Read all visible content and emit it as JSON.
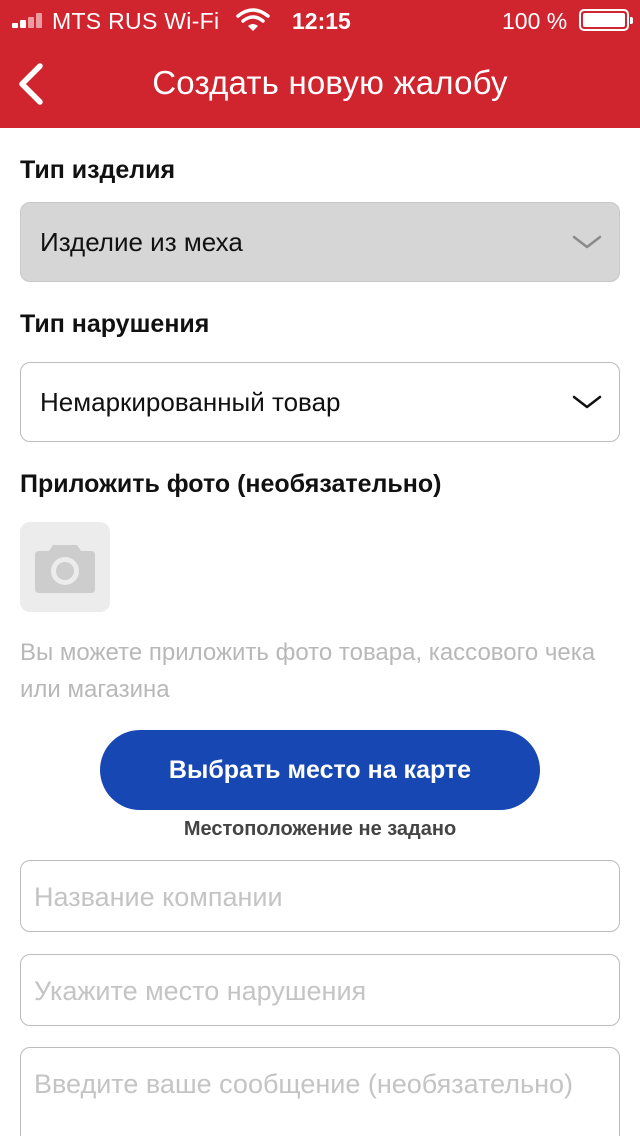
{
  "status_bar": {
    "carrier": "MTS RUS Wi-Fi",
    "time": "12:15",
    "battery": "100 %"
  },
  "nav": {
    "title": "Создать новую жалобу",
    "back_icon": "chevron-left-icon"
  },
  "form": {
    "product_type": {
      "label": "Тип изделия",
      "value": "Изделие из меха"
    },
    "violation_type": {
      "label": "Тип нарушения",
      "value": "Немаркированный товар"
    },
    "photo": {
      "label": "Приложить фото (необязательно)",
      "icon": "camera-icon",
      "hint": "Вы можете приложить фото товара, кассового чека или магазина"
    },
    "map_button": "Выбрать место на карте",
    "location_status": "Местоположение не задано",
    "company_placeholder": "Название компании",
    "place_placeholder": "Укажите место нарушения",
    "message_placeholder": "Введите ваше сообщение (необязательно)"
  },
  "colors": {
    "header": "#d0242e",
    "primary_button": "#1747b3",
    "disabled_field": "#d6d6d6",
    "placeholder": "#c4c4c4"
  }
}
